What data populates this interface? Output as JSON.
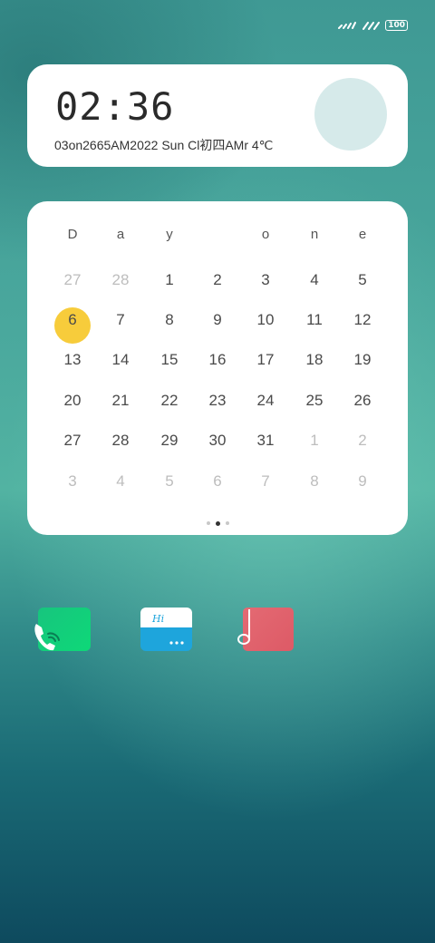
{
  "status_bar": {
    "battery": "100",
    "icons": [
      "signal-icon",
      "signal-icon",
      "battery-icon"
    ]
  },
  "clock": {
    "time": "02:36",
    "info": "03on2665AM2022 Sun Cl初四AMr 4℃"
  },
  "calendar": {
    "weekdays": [
      "D",
      "a",
      "y",
      "",
      "o",
      "n",
      "e"
    ],
    "today": "6",
    "weeks": [
      [
        {
          "d": "27",
          "o": true
        },
        {
          "d": "28",
          "o": true
        },
        {
          "d": "1"
        },
        {
          "d": "2"
        },
        {
          "d": "3"
        },
        {
          "d": "4"
        },
        {
          "d": "5"
        }
      ],
      [
        {
          "d": "6",
          "t": true
        },
        {
          "d": "7"
        },
        {
          "d": "8"
        },
        {
          "d": "9"
        },
        {
          "d": "10"
        },
        {
          "d": "11"
        },
        {
          "d": "12"
        }
      ],
      [
        {
          "d": "13"
        },
        {
          "d": "14"
        },
        {
          "d": "15"
        },
        {
          "d": "16"
        },
        {
          "d": "17"
        },
        {
          "d": "18"
        },
        {
          "d": "19"
        }
      ],
      [
        {
          "d": "20"
        },
        {
          "d": "21"
        },
        {
          "d": "22"
        },
        {
          "d": "23"
        },
        {
          "d": "24"
        },
        {
          "d": "25"
        },
        {
          "d": "26"
        }
      ],
      [
        {
          "d": "27"
        },
        {
          "d": "28"
        },
        {
          "d": "29"
        },
        {
          "d": "30"
        },
        {
          "d": "31"
        },
        {
          "d": "1",
          "o": true
        },
        {
          "d": "2",
          "o": true
        }
      ],
      [
        {
          "d": "3",
          "o": true
        },
        {
          "d": "4",
          "o": true
        },
        {
          "d": "5",
          "o": true
        },
        {
          "d": "6",
          "o": true
        },
        {
          "d": "7",
          "o": true
        },
        {
          "d": "8",
          "o": true
        },
        {
          "d": "9",
          "o": true
        }
      ]
    ],
    "page_count": 3,
    "active_page": 1,
    "today_color": "#f7cc3b"
  },
  "apps": [
    {
      "name": "phone",
      "icon": "phone-icon",
      "color": "#17c57e"
    },
    {
      "name": "messages",
      "icon": "message-icon",
      "label": "Hi",
      "color": "#1ea5dc"
    },
    {
      "name": "music",
      "icon": "music-note-icon",
      "color": "#e46a73"
    }
  ]
}
